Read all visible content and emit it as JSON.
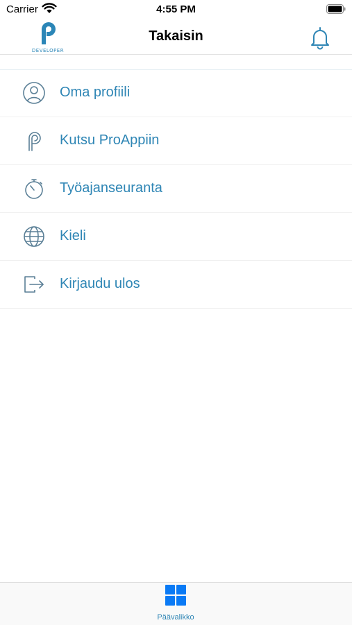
{
  "status_bar": {
    "carrier": "Carrier",
    "time": "4:55 PM"
  },
  "nav": {
    "logo_text": "DEVELOPER",
    "title": "Takaisin",
    "bell_icon": "bell-icon"
  },
  "menu": {
    "items": [
      {
        "label": "Oma profiili",
        "icon": "user-circle-icon"
      },
      {
        "label": "Kutsu ProAppiin",
        "icon": "proapp-logo-icon"
      },
      {
        "label": "Työajanseuranta",
        "icon": "stopwatch-icon"
      },
      {
        "label": "Kieli",
        "icon": "globe-icon"
      },
      {
        "label": "Kirjaudu ulos",
        "icon": "logout-icon"
      }
    ]
  },
  "tab_bar": {
    "items": [
      {
        "label": "Päävalikko",
        "icon": "grid-icon",
        "active": true
      }
    ]
  },
  "colors": {
    "accent": "#2f86b5",
    "tab_active": "#0a7af5",
    "divider": "#f0f0f0"
  }
}
